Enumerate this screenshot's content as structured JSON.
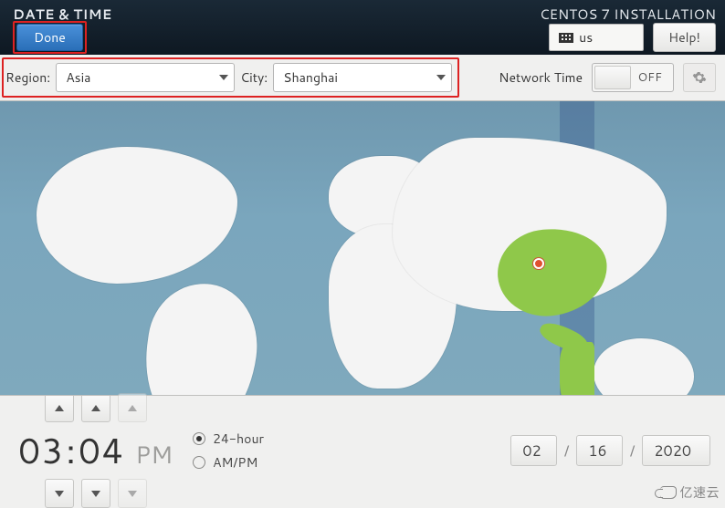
{
  "header": {
    "page_title": "DATE & TIME",
    "installer_title": "CENTOS 7 INSTALLATION",
    "done_label": "Done",
    "help_label": "Help!",
    "keyboard_layout": "us"
  },
  "config": {
    "region_label": "Region:",
    "region_value": "Asia",
    "city_label": "City:",
    "city_value": "Shanghai",
    "network_time_label": "Network Time",
    "network_time_state": "OFF"
  },
  "map": {
    "selected_city": "Shanghai"
  },
  "time": {
    "hour": "03",
    "separator": ":",
    "minute": "04",
    "ampm": "PM",
    "format_24_label": "24-hour",
    "format_ampm_label": "AM/PM",
    "format_selected": "24-hour"
  },
  "date": {
    "month": "02",
    "day": "16",
    "year": "2020",
    "separator": "/"
  },
  "watermark": "亿速云"
}
